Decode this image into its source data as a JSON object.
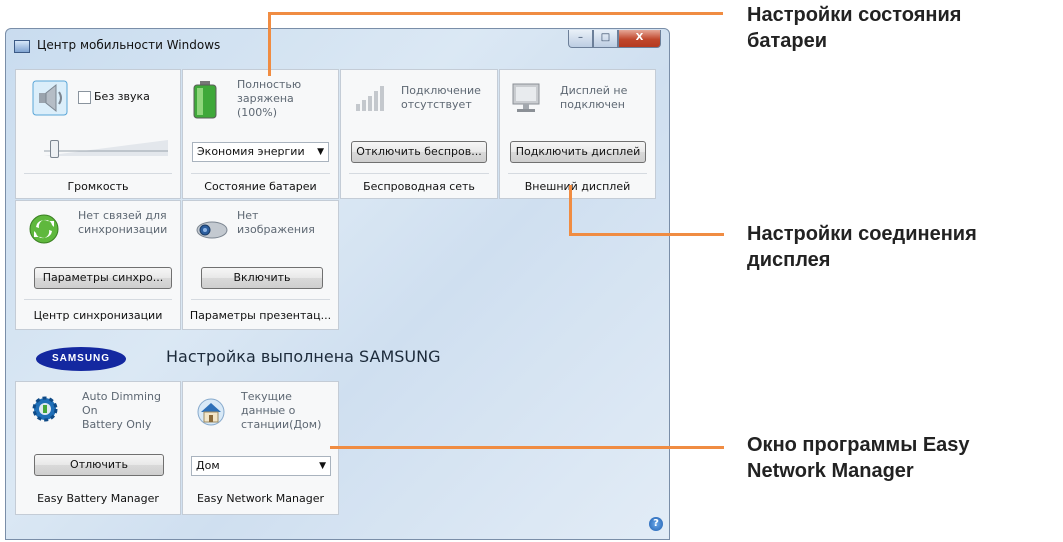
{
  "window": {
    "title": "Центр мобильности Windows",
    "buttons": {
      "minimize": "–",
      "maximize": "□",
      "close": "X"
    }
  },
  "tiles": {
    "volume": {
      "mute_label": "Без звука",
      "caption": "Громкость",
      "slider_level": 0.05,
      "icon": "speaker-icon"
    },
    "battery": {
      "status_line1": "Полностью",
      "status_line2": "заряжена",
      "status_line3": "(100%)",
      "plan_value": "Экономия энергии",
      "caption": "Состояние батареи",
      "icon": "battery-icon"
    },
    "wireless": {
      "status_line1": "Подключение",
      "status_line2": "отсутствует",
      "button_label": "Отключить беспров...",
      "caption": "Беспроводная сеть",
      "icon": "signal-bars-icon"
    },
    "display": {
      "status_line1": "Дисплей не",
      "status_line2": "подключен",
      "button_label": "Подключить дисплей",
      "caption": "Внешний дисплей",
      "icon": "monitor-icon"
    },
    "sync": {
      "status_line1": "Нет связей для",
      "status_line2": "синхронизации",
      "button_label": "Параметры синхро...",
      "caption": "Центр синхронизации",
      "icon": "sync-icon"
    },
    "presentation": {
      "status_line1": "Нет",
      "status_line2": "изображения",
      "button_label": "Включить",
      "caption": "Параметры презентац...",
      "icon": "projector-icon"
    }
  },
  "samsung": {
    "logo_text": "SAMSUNG",
    "heading": "Настройка выполнена SAMSUNG"
  },
  "samsung_tiles": {
    "battery_manager": {
      "status_line1": "Auto Dimming",
      "status_line2": "On",
      "status_line3": "Battery Only",
      "button_label": "Отлючить",
      "caption": "Easy Battery Manager",
      "icon": "gear-battery-icon"
    },
    "network_manager": {
      "status_line1": "Текущие",
      "status_line2": "данные о",
      "status_line3": "станции(Дом)",
      "location_value": "Дом",
      "caption": "Easy Network Manager",
      "icon": "house-icon"
    }
  },
  "help": {
    "icon": "help-icon",
    "glyph": "?"
  },
  "annotations": {
    "battery_settings": {
      "line1": "Настройки состояния",
      "line2": "батареи"
    },
    "display_settings": {
      "line1": "Настройки соединения",
      "line2": "дисплея"
    },
    "network_window": {
      "line1": "Окно программы Easy",
      "line2": "Network Manager"
    }
  },
  "colors": {
    "accent_orange": "#f08c42",
    "samsung_blue": "#1428a0"
  }
}
